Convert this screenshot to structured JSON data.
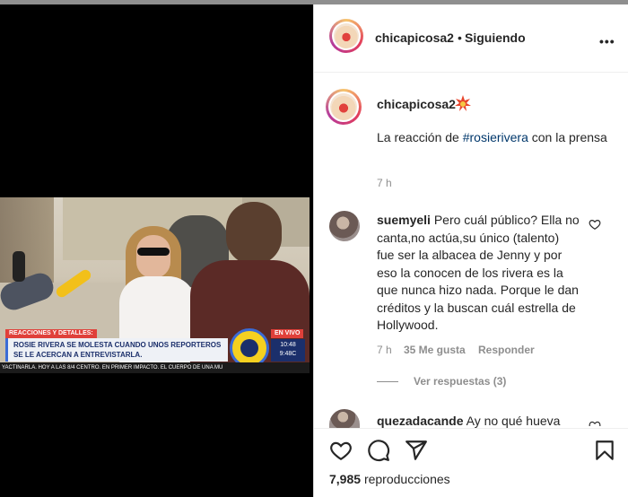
{
  "post": {
    "header_username": "chicapicosa2",
    "header_separator": "•",
    "header_follow_state": "Siguiendo",
    "more_label": "•••",
    "caption_username": "chicapicosa2",
    "caption_pre": "La reacción de ",
    "caption_hashtag": "#rosierivera",
    "caption_post": " con la prensa",
    "time": "7 h"
  },
  "comments": [
    {
      "username": "suemyeli",
      "text": "Pero cuál público? Ella no canta,no actúa,su único (talento) fue ser la albacea de Jenny y por eso la conocen de los rivera es la que nunca hizo nada. Porque le dan créditos y la buscan cuál estrella de Hollywood.",
      "time": "7 h",
      "likes": "35 Me gusta",
      "reply_label": "Responder",
      "view_replies": "Ver respuestas (3)"
    },
    {
      "username": "quezadacande",
      "text": "Ay no qué hueva"
    }
  ],
  "footer": {
    "views_count": "7,985",
    "views_label": "reproducciones"
  },
  "video": {
    "tag_left": "REACCIONES Y DETALLES:",
    "headline": "ROSIE RIVERA SE MOLESTA CUANDO UNOS REPORTEROS SE LE ACERCAN A ENTREVISTARLA.",
    "tag_live": "EN VIVO",
    "clock_time": "10:48",
    "clock_temp": "9:48C",
    "ticker": "YACTINARLA.   HOY A LAS 8/4 CENTRO. EN PRIMER IMPACTO. EL CUERPO DE UNA MU"
  },
  "colors": {
    "hashtag": "#00376b",
    "meta_gray": "#8e8e8e",
    "text": "#262626"
  },
  "icons": [
    "like-icon",
    "comment-icon",
    "share-icon",
    "save-icon",
    "more-icon",
    "heart-icon",
    "fire-emoji-icon"
  ]
}
